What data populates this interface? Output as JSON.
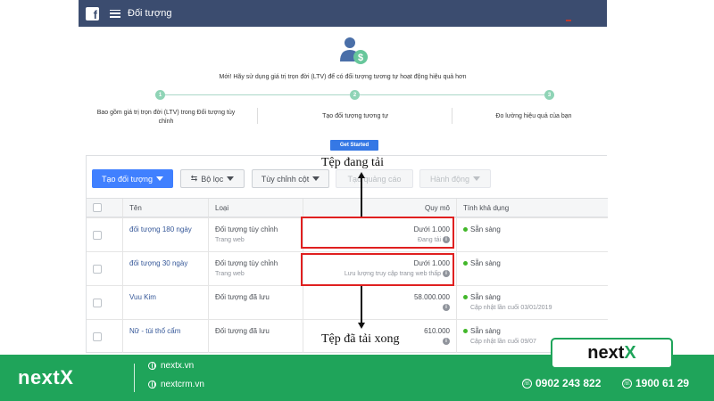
{
  "header": {
    "title": "Đối tượng"
  },
  "onboarding": {
    "message": "Mới! Hãy sử dụng giá trị trọn đời (LTV) để có đối tượng tương tự hoạt động hiệu quả hơn",
    "steps": [
      {
        "number": "1",
        "label": "Bao gồm giá trị trọn đời (LTV) trong Đối tượng tùy chỉnh"
      },
      {
        "number": "2",
        "label": "Tạo đối tượng tương tự"
      },
      {
        "number": "3",
        "label": "Đo lường hiệu quả của bạn"
      }
    ],
    "get_started_label": "Get Started"
  },
  "toolbar": {
    "create_label": "Tạo đối tượng",
    "filter_label": "Bộ lọc",
    "columns_label": "Tùy chỉnh cột",
    "create_ad_label": "Tạo quảng cáo",
    "action_label": "Hành động"
  },
  "table": {
    "columns": [
      "Tên",
      "Loại",
      "Quy mô",
      "Tính khả dụng"
    ],
    "rows": [
      {
        "name": "đối tượng 180 ngày",
        "type": "Đối tượng tùy chỉnh",
        "type_sub": "Trang web",
        "size": "Dưới 1.000",
        "size_sub": "Đang tải",
        "status": "Sẵn sàng",
        "status_sub": ""
      },
      {
        "name": "đối tượng 30 ngày",
        "type": "Đối tượng tùy chỉnh",
        "type_sub": "Trang web",
        "size": "Dưới 1.000",
        "size_sub": "Lưu lượng truy cập trang web thấp",
        "status": "Sẵn sàng",
        "status_sub": ""
      },
      {
        "name": "Vuu Kim",
        "type": "Đối tượng đã lưu",
        "type_sub": "",
        "size": "58.000.000",
        "size_sub": "",
        "status": "Sẵn sàng",
        "status_sub": "Cập nhật lần cuối 03/01/2019"
      },
      {
        "name": "Nữ - túi thổ cẩm",
        "type": "Đối tượng đã lưu",
        "type_sub": "",
        "size": "610.000",
        "size_sub": "",
        "status": "Sẵn sàng",
        "status_sub": "Cập nhật lần cuối 09/07"
      }
    ]
  },
  "annotations": {
    "loading": "Tệp đang tải",
    "loaded": "Tệp đã tải xong"
  },
  "footer": {
    "brand": "nextX",
    "website1": "nextx.vn",
    "website2": "nextcrm.vn",
    "phone1": "0902 243 822",
    "phone2": "1900 61 29",
    "logo_main": "next",
    "logo_accent": "X"
  },
  "colors": {
    "fb_bar": "#3b4c6f",
    "primary_button": "#4080ff",
    "footer_green": "#1fa45a",
    "highlight_red": "#e02020",
    "ready_green": "#42b72a"
  }
}
